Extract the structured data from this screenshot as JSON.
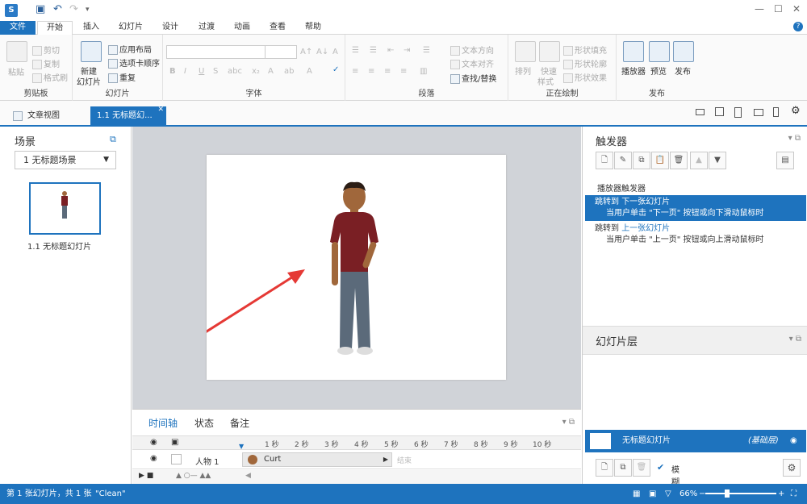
{
  "quick_access": {
    "undo": "↶",
    "redo": "↷",
    "save": "💾"
  },
  "menu": {
    "file": "文件",
    "tabs": [
      "开始",
      "插入",
      "幻灯片",
      "设计",
      "过渡",
      "动画",
      "查看",
      "帮助"
    ]
  },
  "ribbon": {
    "clipboard": {
      "label": "剪贴板",
      "paste": "粘贴",
      "cut": "剪切",
      "copy": "复制",
      "format_painter": "格式刷"
    },
    "slide": {
      "label": "幻灯片",
      "new_slide": "新建",
      "new_slide2": "幻灯片",
      "apply_layout": "应用布局",
      "tab_order": "选项卡顺序",
      "duplicate": "重复"
    },
    "font": {
      "label": "字体"
    },
    "paragraph": {
      "label": "段落",
      "text_direction": "文本方向",
      "align_text": "文本对齐",
      "find_replace": "查找/替换"
    },
    "drawing": {
      "label": "正在绘制",
      "arrange": "排列",
      "quick_styles": "快速",
      "quick_styles2": "样式",
      "shape_fill": "形状填充",
      "shape_outline": "形状轮廓",
      "shape_effect": "形状效果"
    },
    "publish": {
      "label": "发布",
      "player": "播放器",
      "preview": "预览",
      "publish": "发布"
    }
  },
  "doc_tabs": {
    "story_view": "文章视图",
    "slide_tab": "1.1 无标题幻..."
  },
  "left_panel": {
    "title": "场景",
    "scene_select": "1 无标题场景",
    "slide_caption": "1.1 无标题幻灯片"
  },
  "timeline": {
    "tabs": [
      "时间轴",
      "状态",
      "备注"
    ],
    "ticks": [
      "1 秒",
      "2 秒",
      "3 秒",
      "4 秒",
      "5 秒",
      "6 秒",
      "7 秒",
      "8 秒",
      "9 秒",
      "10 秒"
    ],
    "row_label": "人物 1",
    "bar_label": "Curt",
    "end_label": "结束"
  },
  "right_panel": {
    "triggers_title": "触发器",
    "player_triggers": "播放器触发器",
    "triggers": [
      {
        "action": "跳转到",
        "target": "下一张幻灯片",
        "condition": "当用户单击 \"下一页\" 按钮或向下滑动鼠标时"
      },
      {
        "action": "跳转到",
        "target": "上一张幻灯片",
        "condition": "当用户单击 \"上一页\" 按钮或向上滑动鼠标时"
      }
    ],
    "layers_title": "幻灯片层",
    "base_layer": "无标题幻灯片",
    "base_tag": "(基础层)",
    "dim_label": "模糊"
  },
  "statusbar": {
    "slide_count": "第 1 张幻灯片，共 1 张",
    "theme": "\"Clean\"",
    "zoom": "66%"
  },
  "colors": {
    "accent": "#1e73be",
    "arrow": "#e53935",
    "shirt": "#7a1f24",
    "pants": "#5b6a7a",
    "skin": "#a0673b"
  }
}
